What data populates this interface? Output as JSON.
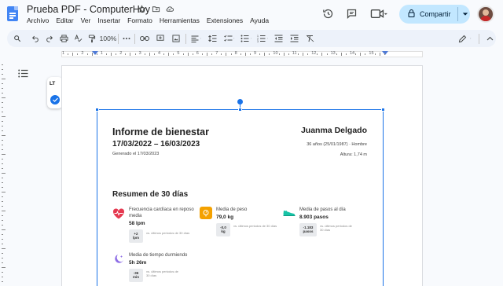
{
  "app": {
    "doc_title": "Prueba PDF - ComputerHoy",
    "menu": [
      "Archivo",
      "Editar",
      "Ver",
      "Insertar",
      "Formato",
      "Herramientas",
      "Extensiones",
      "Ayuda"
    ],
    "share_label": "Compartir"
  },
  "toolbar": {
    "zoom": "100%"
  },
  "ruler": {
    "numbers": [
      "1",
      "2",
      "1",
      "2",
      "3",
      "4",
      "5",
      "6",
      "7",
      "8",
      "9",
      "10",
      "11",
      "12",
      "13",
      "14",
      "15"
    ]
  },
  "addon": {
    "logo_text": "LT"
  },
  "report": {
    "title": "Informe de bienestar",
    "dates": "17/03/2022 – 16/03/2023",
    "generated": "Generado el 17/03/2023",
    "name": "Juanma Delgado",
    "age": "36 años (25/01/1987) · Hombre",
    "height": "Altura: 1,74 m",
    "section": "Resumen de 30 días",
    "metrics": [
      {
        "label": "Frecuencia cardíaca en reposo",
        "label2": "media",
        "value": "58 lpm",
        "badge1": "+2",
        "badge2": "lpm",
        "note1": "vs. últimos periodos de 30 días",
        "note2": ""
      },
      {
        "label": "Media de peso",
        "label2": "",
        "value": "79,0 kg",
        "badge1": "-0,0",
        "badge2": "kg",
        "note1": "vs. últimos periodos de 30 días",
        "note2": ""
      },
      {
        "label": "Media de pasos al día",
        "label2": "",
        "value": "8.903 pasos",
        "badge1": "-1.183",
        "badge2": "pasos",
        "note1": "vs. últimos periodos de",
        "note2": "30 días"
      },
      {
        "label": "Media de tiempo durmiendo",
        "label2": "",
        "value": "5h 26m",
        "badge1": "-36",
        "badge2": "min",
        "note1": "vs. últimos periodos de",
        "note2": "30 días"
      }
    ]
  },
  "colors": {
    "accent": "#1a73e8",
    "share_bg": "#c2e7ff",
    "heart": "#e53950",
    "weight": "#f4a100",
    "steps": "#17c3a6",
    "sleep": "#8e6ee6"
  }
}
